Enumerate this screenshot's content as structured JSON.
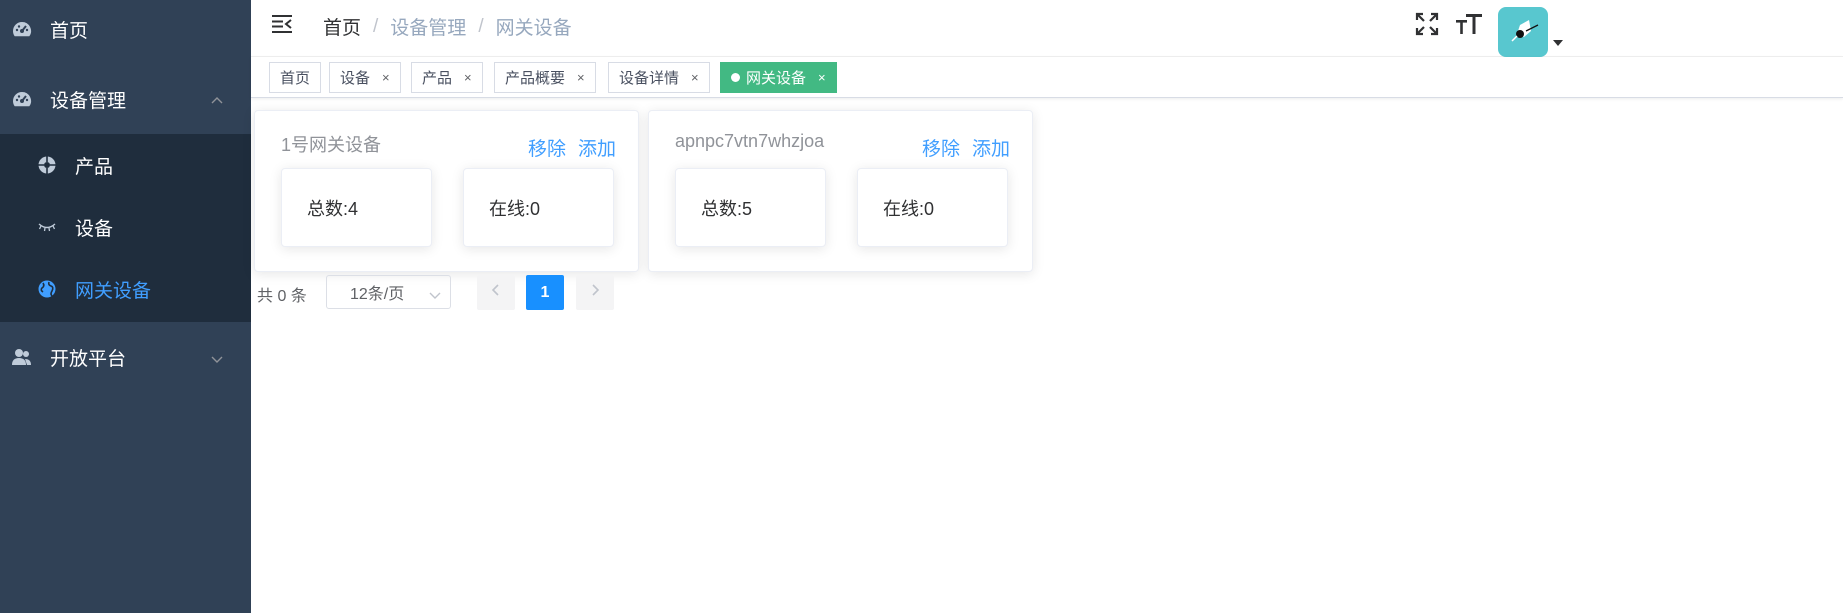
{
  "sidebar": {
    "bg_color": "#304156",
    "submenu_bg_color": "#1f2d3d",
    "active_color": "#409eff",
    "items": [
      {
        "label": "首页",
        "icon": "dashboard-icon"
      },
      {
        "label": "设备管理",
        "icon": "dashboard-icon",
        "expanded": true
      },
      {
        "label": "开放平台",
        "icon": "user-icon",
        "expanded": false
      }
    ],
    "submenu": [
      {
        "label": "产品",
        "icon": "aperture-icon"
      },
      {
        "label": "设备",
        "icon": "eye-closed-icon"
      },
      {
        "label": "网关设备",
        "icon": "globe-icon",
        "active": true
      }
    ]
  },
  "navbar": {
    "breadcrumb": [
      "首页",
      "设备管理",
      "网关设备"
    ],
    "icons": [
      "hamburger-icon",
      "fullscreen-icon",
      "font-size-icon",
      "avatar",
      "caret-down-icon"
    ]
  },
  "tags": [
    {
      "label": "首页",
      "closable": false
    },
    {
      "label": "设备",
      "closable": true
    },
    {
      "label": "产品",
      "closable": true
    },
    {
      "label": "产品概要",
      "closable": true
    },
    {
      "label": "设备详情",
      "closable": true
    },
    {
      "label": "网关设备",
      "closable": true,
      "active": true
    }
  ],
  "tag_close_glyph": "×",
  "tag_active_color": "#42b983",
  "cards": [
    {
      "title": "1号网关设备",
      "remove": "移除",
      "add": "添加",
      "total": "总数:4",
      "online": "在线:0"
    },
    {
      "title": "apnpc7vtn7whzjoa",
      "remove": "移除",
      "add": "添加",
      "total": "总数:5",
      "online": "在线:0"
    }
  ],
  "pagination": {
    "total": "共 0 条",
    "page_size": "12条/页",
    "current_page": "1",
    "active_color": "#1890ff"
  }
}
